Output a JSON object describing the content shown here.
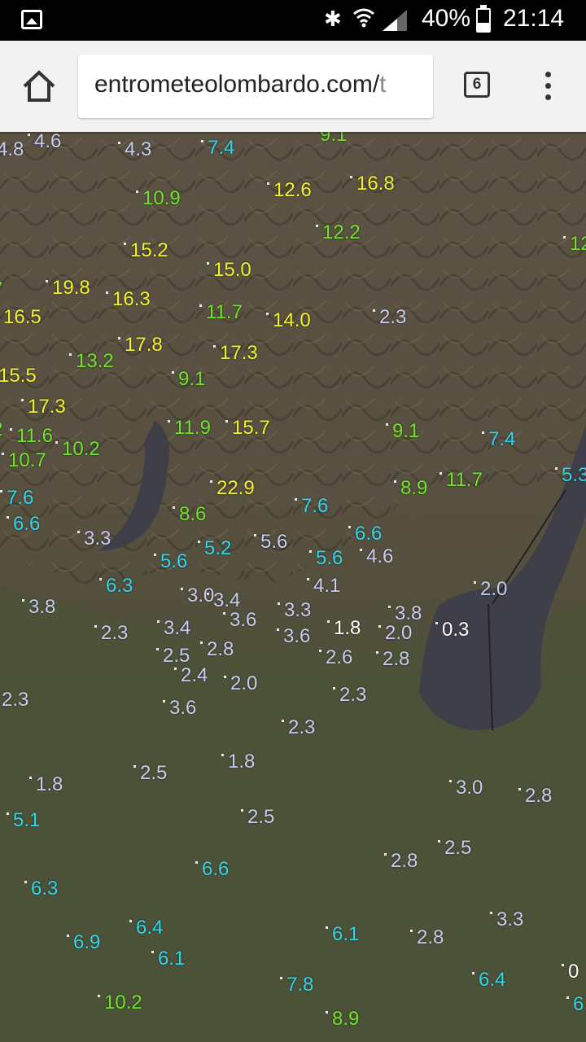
{
  "status_bar": {
    "bluetooth_icon": "bluetooth-icon",
    "wifi_icon": "wifi-icon",
    "battery_percent": "40%",
    "time": "21:14"
  },
  "browser": {
    "url_visible": "entrometeolombardo.com/",
    "url_faded": "t",
    "tab_count": "6"
  },
  "colors": {
    "low": "#c7cdf2",
    "cyan": "#2fd7ee",
    "green": "#6fe42a",
    "yellow": "#f1f22a",
    "white": "#ffffff",
    "lake": "#3f3f4a"
  },
  "map_values": [
    {
      "v": "4.8",
      "c": "low"
    },
    {
      "v": "4.6",
      "c": "low"
    },
    {
      "v": "4.3",
      "c": "low"
    },
    {
      "v": "7.4",
      "c": "cyan"
    },
    {
      "v": "9.1",
      "c": "green"
    },
    {
      "v": "10.9",
      "c": "green"
    },
    {
      "v": "12.6",
      "c": "yellow"
    },
    {
      "v": "16.8",
      "c": "yellow"
    },
    {
      "v": "12.2",
      "c": "green"
    },
    {
      "v": "15.2",
      "c": "yellow"
    },
    {
      "v": "15.0",
      "c": "yellow"
    },
    {
      "v": "12",
      "c": "green"
    },
    {
      "v": "7",
      "c": "green"
    },
    {
      "v": "19.8",
      "c": "yellow"
    },
    {
      "v": "16.3",
      "c": "yellow"
    },
    {
      "v": "11.7",
      "c": "green"
    },
    {
      "v": "14.0",
      "c": "yellow"
    },
    {
      "v": "2.3",
      "c": "low"
    },
    {
      "v": "16.5",
      "c": "yellow"
    },
    {
      "v": "17.8",
      "c": "yellow"
    },
    {
      "v": "13.2",
      "c": "green"
    },
    {
      "v": "17.3",
      "c": "yellow"
    },
    {
      "v": "15.5",
      "c": "yellow"
    },
    {
      "v": "9.1",
      "c": "green"
    },
    {
      "v": "17.3",
      "c": "yellow"
    },
    {
      "v": "2",
      "c": "green"
    },
    {
      "v": "11.6",
      "c": "green"
    },
    {
      "v": "11.9",
      "c": "green"
    },
    {
      "v": "15.7",
      "c": "yellow"
    },
    {
      "v": "9.1",
      "c": "green"
    },
    {
      "v": "10.7",
      "c": "green"
    },
    {
      "v": "10.2",
      "c": "green"
    },
    {
      "v": "7.4",
      "c": "cyan"
    },
    {
      "v": "22.9",
      "c": "yellow"
    },
    {
      "v": "8.9",
      "c": "green"
    },
    {
      "v": "11.7",
      "c": "green"
    },
    {
      "v": "5.3",
      "c": "cyan"
    },
    {
      "v": "7.6",
      "c": "cyan"
    },
    {
      "v": "8.6",
      "c": "green"
    },
    {
      "v": "7.6",
      "c": "cyan"
    },
    {
      "v": "6.6",
      "c": "cyan"
    },
    {
      "v": "6.6",
      "c": "cyan"
    },
    {
      "v": "3.3",
      "c": "low"
    },
    {
      "v": "5.6",
      "c": "cyan"
    },
    {
      "v": "4.6",
      "c": "low"
    },
    {
      "v": "5.2",
      "c": "cyan"
    },
    {
      "v": "5.6",
      "c": "cyan"
    },
    {
      "v": "5.6",
      "c": "cyan"
    },
    {
      "v": "5.6",
      "c": "low"
    },
    {
      "v": "6.3",
      "c": "cyan"
    },
    {
      "v": "3.0",
      "c": "low"
    },
    {
      "v": "3.4",
      "c": "low"
    },
    {
      "v": "4.1",
      "c": "low"
    },
    {
      "v": "2.0",
      "c": "low"
    },
    {
      "v": "3.8",
      "c": "low"
    },
    {
      "v": "3.3",
      "c": "low"
    },
    {
      "v": "3.8",
      "c": "low"
    },
    {
      "v": "2.3",
      "c": "low"
    },
    {
      "v": "3.4",
      "c": "low"
    },
    {
      "v": "3.6",
      "c": "low"
    },
    {
      "v": "3.6",
      "c": "low"
    },
    {
      "v": "1.8",
      "c": "white"
    },
    {
      "v": "2.0",
      "c": "low"
    },
    {
      "v": "0.3",
      "c": "white"
    },
    {
      "v": "2.5",
      "c": "low"
    },
    {
      "v": "2.8",
      "c": "low"
    },
    {
      "v": "2.6",
      "c": "low"
    },
    {
      "v": "2.8",
      "c": "low"
    },
    {
      "v": "2.4",
      "c": "low"
    },
    {
      "v": "2.0",
      "c": "low"
    },
    {
      "v": "2.3",
      "c": "low"
    },
    {
      "v": "2.3",
      "c": "low"
    },
    {
      "v": "3.6",
      "c": "low"
    },
    {
      "v": "2.3",
      "c": "low"
    },
    {
      "v": "2.5",
      "c": "low"
    },
    {
      "v": "1.8",
      "c": "low"
    },
    {
      "v": "1.8",
      "c": "low"
    },
    {
      "v": "3.0",
      "c": "low"
    },
    {
      "v": "2.8",
      "c": "low"
    },
    {
      "v": "5.1",
      "c": "cyan"
    },
    {
      "v": "2.5",
      "c": "low"
    },
    {
      "v": "2.8",
      "c": "low"
    },
    {
      "v": "2.5",
      "c": "low"
    },
    {
      "v": "6.6",
      "c": "cyan"
    },
    {
      "v": "6.3",
      "c": "cyan"
    },
    {
      "v": "3.3",
      "c": "low"
    },
    {
      "v": "6.4",
      "c": "cyan"
    },
    {
      "v": "6.1",
      "c": "cyan"
    },
    {
      "v": "2.8",
      "c": "low"
    },
    {
      "v": "6.9",
      "c": "cyan"
    },
    {
      "v": "6.1",
      "c": "cyan"
    },
    {
      "v": "7.8",
      "c": "cyan"
    },
    {
      "v": "6.4",
      "c": "cyan"
    },
    {
      "v": "0",
      "c": "white"
    },
    {
      "v": "10.2",
      "c": "green"
    },
    {
      "v": "8.9",
      "c": "green"
    },
    {
      "v": "6",
      "c": "cyan"
    }
  ]
}
